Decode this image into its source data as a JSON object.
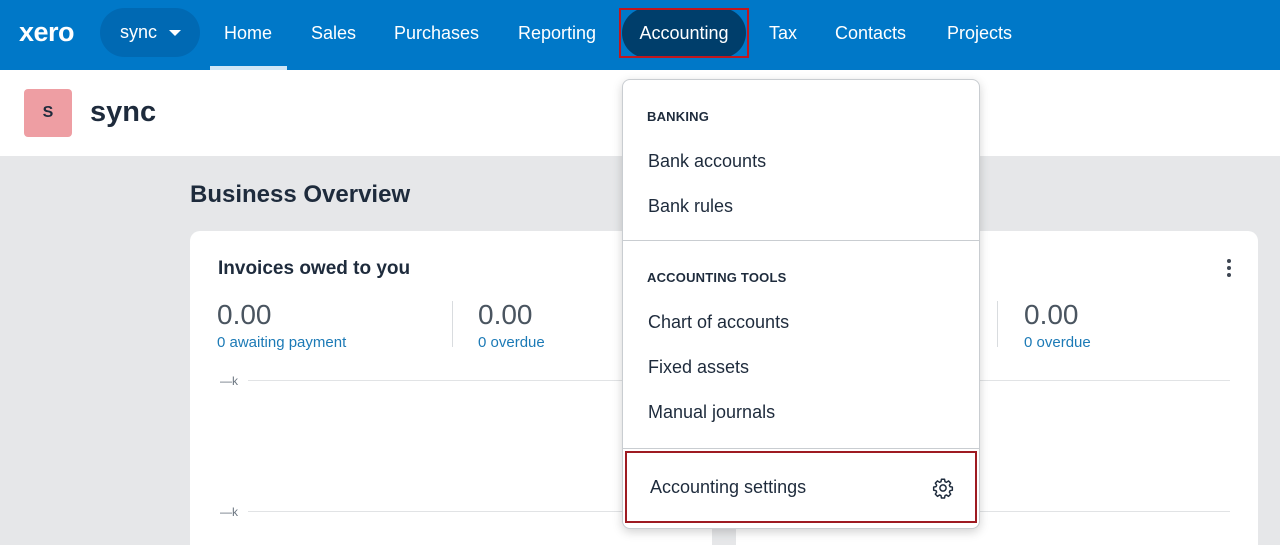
{
  "nav": {
    "logo": "xero",
    "org_switcher": "sync",
    "items": [
      {
        "label": "Home"
      },
      {
        "label": "Sales"
      },
      {
        "label": "Purchases"
      },
      {
        "label": "Reporting"
      },
      {
        "label": "Accounting"
      },
      {
        "label": "Tax"
      },
      {
        "label": "Contacts"
      },
      {
        "label": "Projects"
      }
    ],
    "active": "Home"
  },
  "org": {
    "avatar_letter": "S",
    "name": "sync"
  },
  "main": {
    "title": "Business Overview",
    "invoices_card": {
      "title": "Invoices owed to you",
      "awaiting_value": "0.00",
      "awaiting_label": "0 awaiting payment",
      "overdue_value": "0.00",
      "overdue_label": "0 overdue",
      "axis_top": "—k",
      "axis_bottom": "—k"
    },
    "right_card": {
      "overdue_value": "0.00",
      "overdue_label": "0 overdue"
    }
  },
  "accounting_menu": {
    "banking_heading": "BANKING",
    "bank_accounts": "Bank accounts",
    "bank_rules": "Bank rules",
    "tools_heading": "ACCOUNTING TOOLS",
    "chart_of_accounts": "Chart of accounts",
    "fixed_assets": "Fixed assets",
    "manual_journals": "Manual journals",
    "settings": "Accounting settings"
  },
  "colors": {
    "nav_bg": "#0078c8",
    "nav_active_pill": "#003e6b",
    "highlight": "#c0171e",
    "link": "#1c7ab6",
    "avatar": "#ee9ea3"
  }
}
